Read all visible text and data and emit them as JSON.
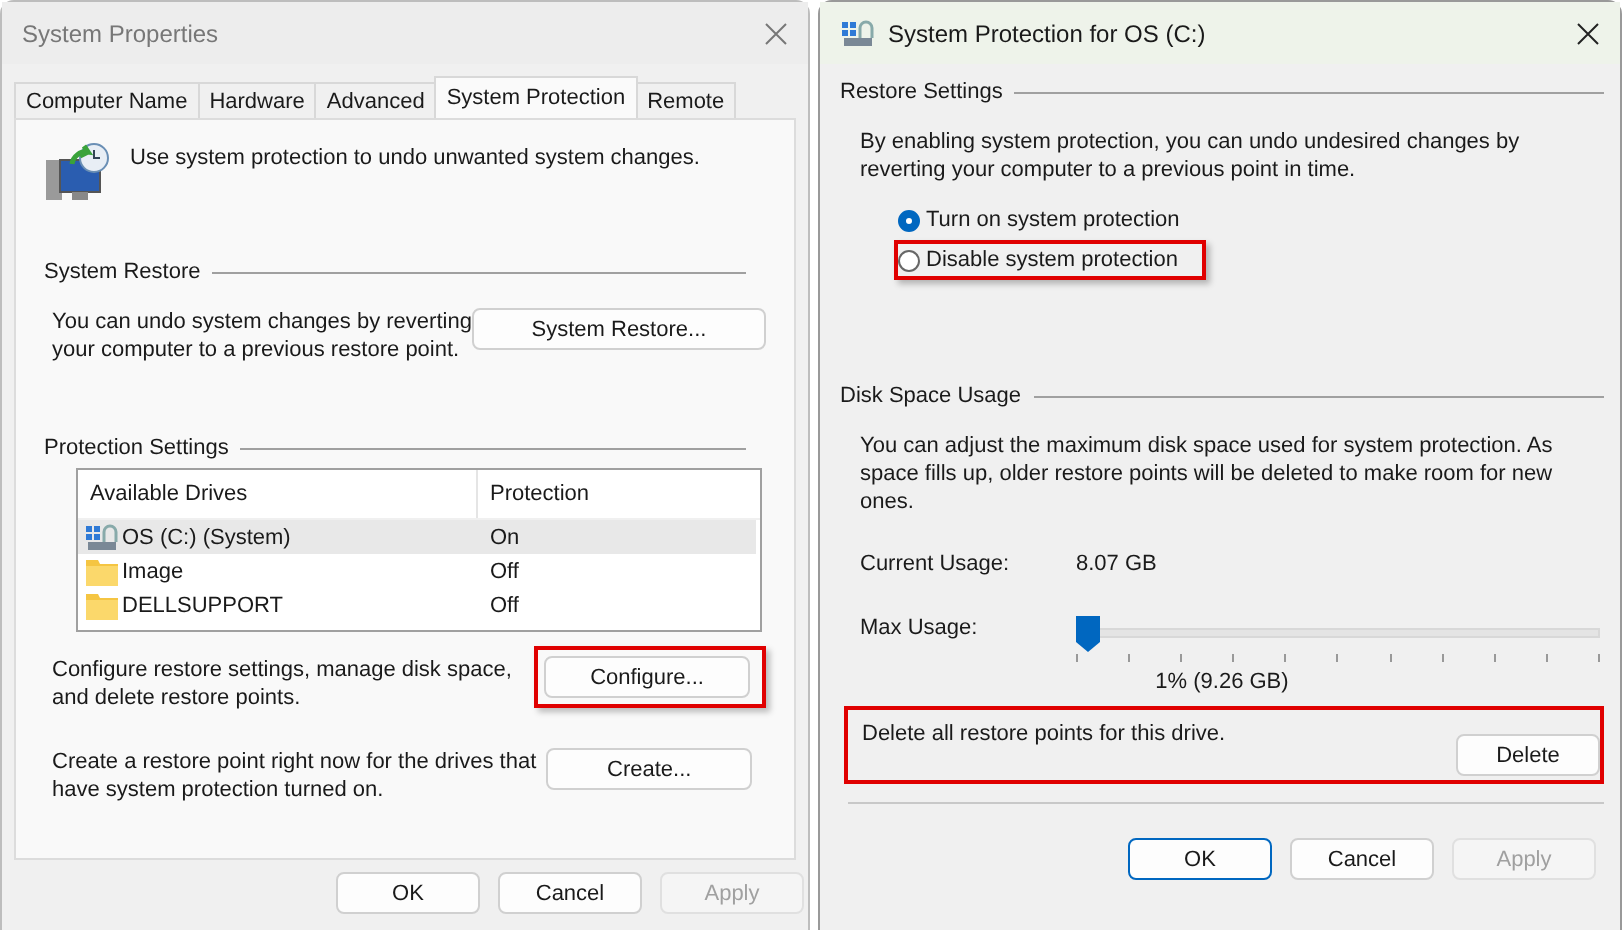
{
  "system_properties": {
    "title": "System Properties",
    "tabs": [
      {
        "label": "Computer Name",
        "selected": false
      },
      {
        "label": "Hardware",
        "selected": false
      },
      {
        "label": "Advanced",
        "selected": false
      },
      {
        "label": "System Protection",
        "selected": true
      },
      {
        "label": "Remote",
        "selected": false
      }
    ],
    "intro": "Use system protection to undo unwanted system changes.",
    "system_restore": {
      "heading": "System Restore",
      "text": "You can undo system changes by reverting\nyour computer to a previous restore point.",
      "button": "System Restore..."
    },
    "protection_settings": {
      "heading": "Protection Settings",
      "columns": [
        "Available Drives",
        "Protection"
      ],
      "drives": [
        {
          "name": "OS (C:) (System)",
          "kind": "system",
          "protection": "On",
          "selected": true
        },
        {
          "name": "Image",
          "kind": "folder",
          "protection": "Off",
          "selected": false
        },
        {
          "name": "DELLSUPPORT",
          "kind": "folder",
          "protection": "Off",
          "selected": false
        }
      ],
      "actions": [
        {
          "text": "Configure restore settings, manage disk space,\nand delete restore points.",
          "button": "Configure...",
          "highlighted": true
        },
        {
          "text": "Create a restore point right now for the drives that\nhave system protection turned on.",
          "button": "Create...",
          "highlighted": false
        }
      ]
    },
    "buttons": [
      {
        "label": "OK",
        "disabled": false,
        "default": false
      },
      {
        "label": "Cancel",
        "disabled": false,
        "default": false
      },
      {
        "label": "Apply",
        "disabled": true,
        "default": false
      }
    ]
  },
  "protection_dialog": {
    "title": "System Protection for OS (C:)",
    "restore_settings": {
      "heading": "Restore Settings",
      "text": "By enabling system protection, you can undo undesired changes by\nreverting your computer to a previous point in time.",
      "options": [
        {
          "label": "Turn on system protection",
          "selected": true,
          "highlighted": false
        },
        {
          "label": "Disable system protection",
          "selected": false,
          "highlighted": true
        }
      ]
    },
    "disk_space": {
      "heading": "Disk Space Usage",
      "text": "You can adjust the maximum disk space used for system protection. As\nspace fills up, older restore points will be deleted to make room for new\nones.",
      "current_label": "Current Usage:",
      "current_value": "8.07 GB",
      "max_label": "Max Usage:",
      "level": 0.0,
      "max_reading": "1% (9.26 GB)",
      "delete": {
        "text": "Delete all restore points for this drive.",
        "button": "Delete",
        "highlighted": true
      }
    },
    "buttons": [
      {
        "label": "OK",
        "disabled": false,
        "default": true
      },
      {
        "label": "Cancel",
        "disabled": false,
        "default": false
      },
      {
        "label": "Apply",
        "disabled": true,
        "default": false
      }
    ]
  }
}
